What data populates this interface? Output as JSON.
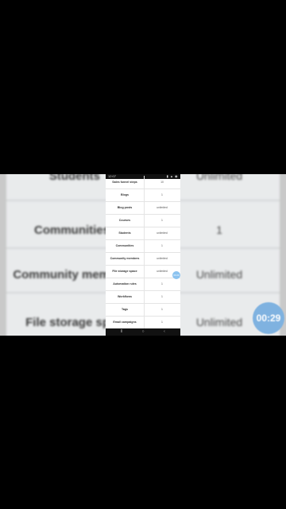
{
  "background": {
    "rows": [
      {
        "label": "Students",
        "value": "Unlimited"
      },
      {
        "label": "Communities",
        "value": "1"
      },
      {
        "label": "Community mem",
        "value": "Unlimited"
      },
      {
        "label": "File storage sp",
        "value": "Unlimited"
      }
    ],
    "timer": "00:29"
  },
  "phone": {
    "status_time": "12:07",
    "status_icons": "▮ ▲ ◉",
    "rows": [
      {
        "label": "Sales funnel steps",
        "value": "10"
      },
      {
        "label": "Blogs",
        "value": "1"
      },
      {
        "label": "Blog posts",
        "value": "unlimited"
      },
      {
        "label": "Courses",
        "value": "1"
      },
      {
        "label": "Students",
        "value": "unlimited"
      },
      {
        "label": "Communities",
        "value": "1"
      },
      {
        "label": "Community members",
        "value": "unlimited"
      },
      {
        "label": "File storage space",
        "value": "unlimited"
      },
      {
        "label": "Automation rules",
        "value": "1"
      },
      {
        "label": "Workflows",
        "value": "1"
      },
      {
        "label": "Tags",
        "value": "1"
      },
      {
        "label": "Email campaigns",
        "value": "1"
      }
    ],
    "timer_mini": "00:29",
    "nav": {
      "recents": "⦀",
      "home": "○",
      "back": "‹"
    }
  },
  "colors": {
    "accent": "#8cc3ef"
  }
}
